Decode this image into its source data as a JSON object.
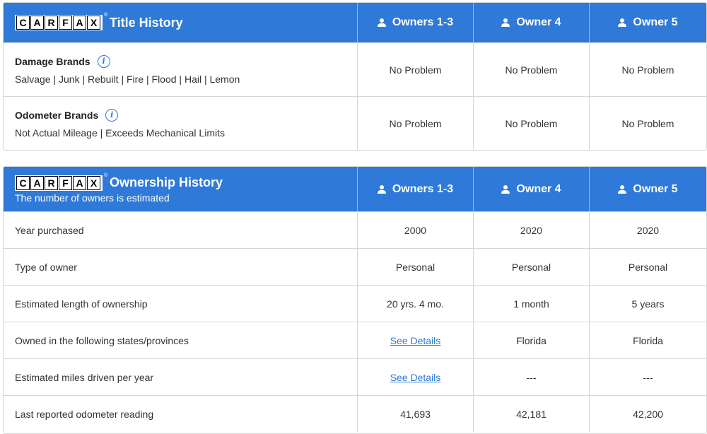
{
  "logo": {
    "letters": [
      "C",
      "A",
      "R",
      "F",
      "A",
      "X"
    ],
    "trademark": "®"
  },
  "title_history": {
    "title": "Title History",
    "owners": [
      "Owners 1-3",
      "Owner 4",
      "Owner 5"
    ],
    "rows": [
      {
        "name": "Damage Brands",
        "desc": "Salvage | Junk | Rebuilt | Fire | Flood | Hail | Lemon",
        "values": [
          "No Problem",
          "No Problem",
          "No Problem"
        ]
      },
      {
        "name": "Odometer Brands",
        "desc": "Not Actual Mileage | Exceeds Mechanical Limits",
        "values": [
          "No Problem",
          "No Problem",
          "No Problem"
        ]
      }
    ]
  },
  "ownership_history": {
    "title": "Ownership History",
    "subtitle": "The number of owners is estimated",
    "owners": [
      "Owners 1-3",
      "Owner 4",
      "Owner 5"
    ],
    "rows": [
      {
        "label": "Year purchased",
        "values": [
          "2000",
          "2020",
          "2020"
        ]
      },
      {
        "label": "Type of owner",
        "values": [
          "Personal",
          "Personal",
          "Personal"
        ]
      },
      {
        "label": "Estimated length of ownership",
        "values": [
          "20 yrs. 4 mo.",
          "1 month",
          "5 years"
        ]
      },
      {
        "label": "Owned in the following states/provinces",
        "values": [
          "See Details",
          "Florida",
          "Florida"
        ]
      },
      {
        "label": "Estimated miles driven per year",
        "values": [
          "See Details",
          "---",
          "---"
        ]
      },
      {
        "label": "Last reported odometer reading",
        "values": [
          "41,693",
          "42,181",
          "42,200"
        ]
      }
    ]
  },
  "icons": {
    "owner": "person-icon",
    "info": "info-icon"
  },
  "colors": {
    "header_bg": "#2f7ad9",
    "link": "#2f7ad9",
    "border": "#d6d6d6"
  }
}
